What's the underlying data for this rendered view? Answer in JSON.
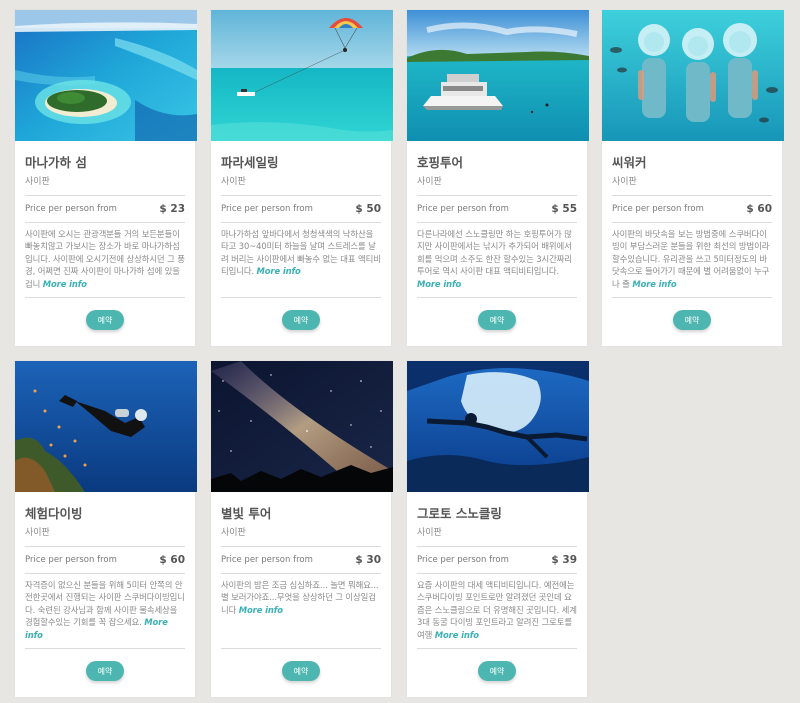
{
  "tours": [
    {
      "title": "마나가하 섬",
      "subtitle": "사이판",
      "price_label": "Price per person from",
      "price": "$ 23",
      "description": "사이판에 오시는 관광객분들 거의 보든분들이 빠놓치않고 가보시는 장소가 바로 마나가하섬 입니다. 사이판에 오시기전에 상상하시던 그 풍경, 어쩌면 진짜 사이판이 마나가하 섬에 있을겁니",
      "more": "More info",
      "button": "예약",
      "image": "island-photo"
    },
    {
      "title": "파라세일링",
      "subtitle": "사이판",
      "price_label": "Price per person from",
      "price": "$ 50",
      "description": "마나가하섬 앞바다에서 청청색색의 낙하산을 타고 30~40미터 하늘을 날며 스트레스를 날려 버리는 사이판에서 빠놓수 없는 대표 액티비티입니다.",
      "more": "More info",
      "button": "예약",
      "image": "parasail-photo"
    },
    {
      "title": "호핑투어",
      "subtitle": "사이판",
      "price_label": "Price per person from",
      "price": "$ 55",
      "description": "다른나라에선 스노클링만 하는 호핑투어가 많지만 사이판에서는 낚시가 추가되어 배위에서 회를 먹으며 소주도 한잔 할수있는 3시간짜리 투어로 역시 사이판 대표 액티비티입니다.",
      "more": "More info",
      "button": "예약",
      "image": "boat-photo"
    },
    {
      "title": "씨워커",
      "subtitle": "사이판",
      "price_label": "Price per person from",
      "price": "$ 60",
      "description": "사이판의 바닷속을 보는 방법중에 스쿠버다이빙이 부담스러운 분들을 위한 최선의 방법이라 할수있습니다. 유리관을 쓰고 5미터정도의 바닷속으로 들어가기 때문에 별 어려움없이 누구나 즐",
      "more": "More info",
      "button": "예약",
      "image": "seawalker-photo"
    },
    {
      "title": "체험다이빙",
      "subtitle": "사이판",
      "price_label": "Price per person from",
      "price": "$ 60",
      "description": "자격증이 없으신 분들을 위해 5미터 안쪽의 안전한곳에서 진행되는 사이판 스쿠버다이빙입니다. 숙련된 강사님과 함께 사이판 물속세상을 경험할수있는 기회를 꼭 잡으세요.",
      "more": "More info",
      "button": "예약",
      "image": "diver-photo"
    },
    {
      "title": "별빛 투어",
      "subtitle": "사이판",
      "price_label": "Price per person from",
      "price": "$ 30",
      "description": "사이판의 밤은 조금 심심하죠... 놀면 뭐해요... 별 보러가야죠...무엇을 상상하던 그 이상일겁니다",
      "more": "More info",
      "button": "예약",
      "image": "milkyway-photo"
    },
    {
      "title": "그로토 스노클링",
      "subtitle": "사이판",
      "price_label": "Price per person from",
      "price": "$ 39",
      "description": "요즘 사이판의 대세 액티비티입니다. 예전에는 스쿠버다이빙 포인트로만 알려졌던 곳인데 요즘은 스노클링으로 더 유명해진 곳입니다. 세계3대 동굴 다이빙 포인트라고 알려진 그로토를 여행",
      "more": "More info",
      "button": "예약",
      "image": "grotto-photo"
    }
  ],
  "colors": {
    "accent": "#4db6b0",
    "link": "#3ab0b4",
    "background": "#e8e6e2"
  }
}
